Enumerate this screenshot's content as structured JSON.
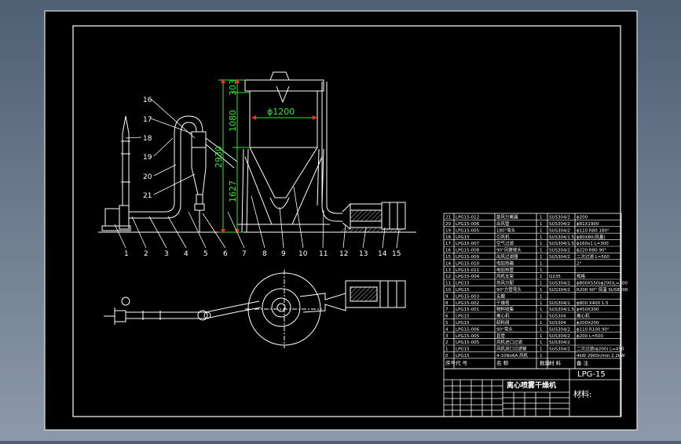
{
  "drawing": {
    "model": "LPG-15",
    "title_cn": "离心喷雾干燥机",
    "material_label": "材料:",
    "colors": {
      "canvas_bg": "#000000",
      "line": "#ffffff",
      "dimension": "#2eea2e",
      "annotation": "#ff2a2a",
      "viewport_bg": "#4f5f74"
    },
    "dimensions": {
      "d1": "303",
      "d2": "1080",
      "d3": "2930",
      "d4": "1627",
      "diameter": "ϕ1200"
    },
    "balloons_bottom": [
      "1",
      "2",
      "3",
      "4",
      "5",
      "6",
      "7",
      "8",
      "9",
      "10",
      "11",
      "12",
      "13",
      "14",
      "15"
    ],
    "balloons_left": [
      "16",
      "17",
      "18",
      "19",
      "20",
      "21"
    ],
    "bom": {
      "headers": [
        "序号",
        "代 号",
        "名 称",
        "数量",
        "材 料",
        "备 注"
      ],
      "rows": [
        {
          "no": "21",
          "code": "LPG15-012",
          "name": "旋风分离器",
          "qty": "1",
          "mat": "SUS304/2",
          "note": "ϕ200"
        },
        {
          "no": "20",
          "code": "LPG15-006",
          "name": "出风管",
          "qty": "1",
          "mat": "SUS304/2",
          "note": "ϕ81X1900"
        },
        {
          "no": "19",
          "code": "LPG15-005",
          "name": "180°弯头",
          "qty": "1",
          "mat": "SUS304/2",
          "note": "ϕ110 R80 180°"
        },
        {
          "no": "18",
          "code": "LPG15",
          "name": "引风机",
          "qty": "1",
          "mat": "SUS304/1.5",
          "note": "ϕ80X80(风量)"
        },
        {
          "no": "17",
          "code": "LPG15-007",
          "name": "空气过滤",
          "qty": "1",
          "mat": "SUS304/1.5",
          "note": "ϕ160x1 L=300"
        },
        {
          "no": "16",
          "code": "LPG15-008",
          "name": "90°风管接头",
          "qty": "1",
          "mat": "SUS304/2",
          "note": "ϕ220 R80 90°"
        },
        {
          "no": "15",
          "code": "LPG15-009",
          "name": "出风过滤器",
          "qty": "1",
          "mat": "SUS304/2",
          "note": "二次过滤 L=500"
        },
        {
          "no": "14",
          "code": "LPG15-010",
          "name": "电加热箱",
          "qty": "1",
          "mat": "",
          "note": "2°"
        },
        {
          "no": "13",
          "code": "LPG15-011",
          "name": "电加热管",
          "qty": "1",
          "mat": "",
          "note": ""
        },
        {
          "no": "12",
          "code": "LPG15-004",
          "name": "风机支架",
          "qty": "1",
          "mat": "Q235",
          "note": "规格"
        },
        {
          "no": "11",
          "code": "LPG15",
          "name": "热风分配",
          "qty": "1",
          "mat": "SUS304/2",
          "note": "ϕ800X550(ϕ200)L=300"
        },
        {
          "no": "10",
          "code": "LPG15",
          "name": "90°方管弯头",
          "qty": "1",
          "mat": "SUS304/2",
          "note": "R200 90° 保温 SUS8200"
        },
        {
          "no": "9",
          "code": "LPG15-003",
          "name": "支腿",
          "qty": "1",
          "mat": "",
          "note": ""
        },
        {
          "no": "8",
          "code": "LPG15-002",
          "name": "干燥塔",
          "qty": "1",
          "mat": "SUS304/1",
          "note": "ϕ800 X400 1.5"
        },
        {
          "no": "7",
          "code": "LPG15-001",
          "name": "物料收集",
          "qty": "1",
          "mat": "SUS304/1.5",
          "note": "ϕ450X300"
        },
        {
          "no": "6",
          "code": "LPG15",
          "name": "离心机",
          "qty": "1",
          "mat": "SUS304",
          "note": "离心机"
        },
        {
          "no": "5",
          "code": "LPG15",
          "name": "卸料阀",
          "qty": "1",
          "mat": "SUS304",
          "note": "ϕ200X200"
        },
        {
          "no": "4",
          "code": "LPG15-006",
          "name": "90°弯头",
          "qty": "1",
          "mat": "SUS304/2",
          "note": "ϕ110 R100 90°"
        },
        {
          "no": "3",
          "code": "LPG15-005",
          "name": "直管",
          "qty": "1",
          "mat": "SUS304/2",
          "note": "ϕ200 L=500"
        },
        {
          "no": "2",
          "code": "LPG15-005",
          "name": "风机进口过滤",
          "qty": "1",
          "mat": "SUS304/2",
          "note": ""
        },
        {
          "no": "1",
          "code": "LPG15",
          "name": "风机进口过滤管",
          "qty": "1",
          "mat": "SUS304/2",
          "note": "二次过滤(ϕ200) L=450"
        },
        {
          "no": "0",
          "code": "LPG15",
          "name": "4-10No6A 风机",
          "qty": "1",
          "mat": "",
          "note": "4kW 2900r/min 2.2kW"
        }
      ]
    }
  }
}
